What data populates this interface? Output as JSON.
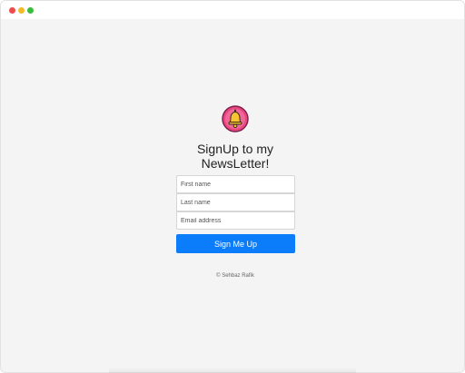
{
  "window": {
    "title_bar_buttons": [
      "close",
      "minimize",
      "maximize"
    ],
    "colors": {
      "close": "#ee4b4b",
      "minimize": "#f3b929",
      "maximize": "#3bbd3b"
    }
  },
  "signup": {
    "logo_icon": "bell-icon",
    "heading_line1": "SignUp to my",
    "heading_line2": "NewsLetter!",
    "first_name_placeholder": "First name",
    "last_name_placeholder": "Last name",
    "email_placeholder": "Email address",
    "submit_label": "Sign Me Up",
    "accent_color": "#0b7dfb"
  },
  "footer": {
    "copyright": "© Sehbaz Rafik"
  }
}
